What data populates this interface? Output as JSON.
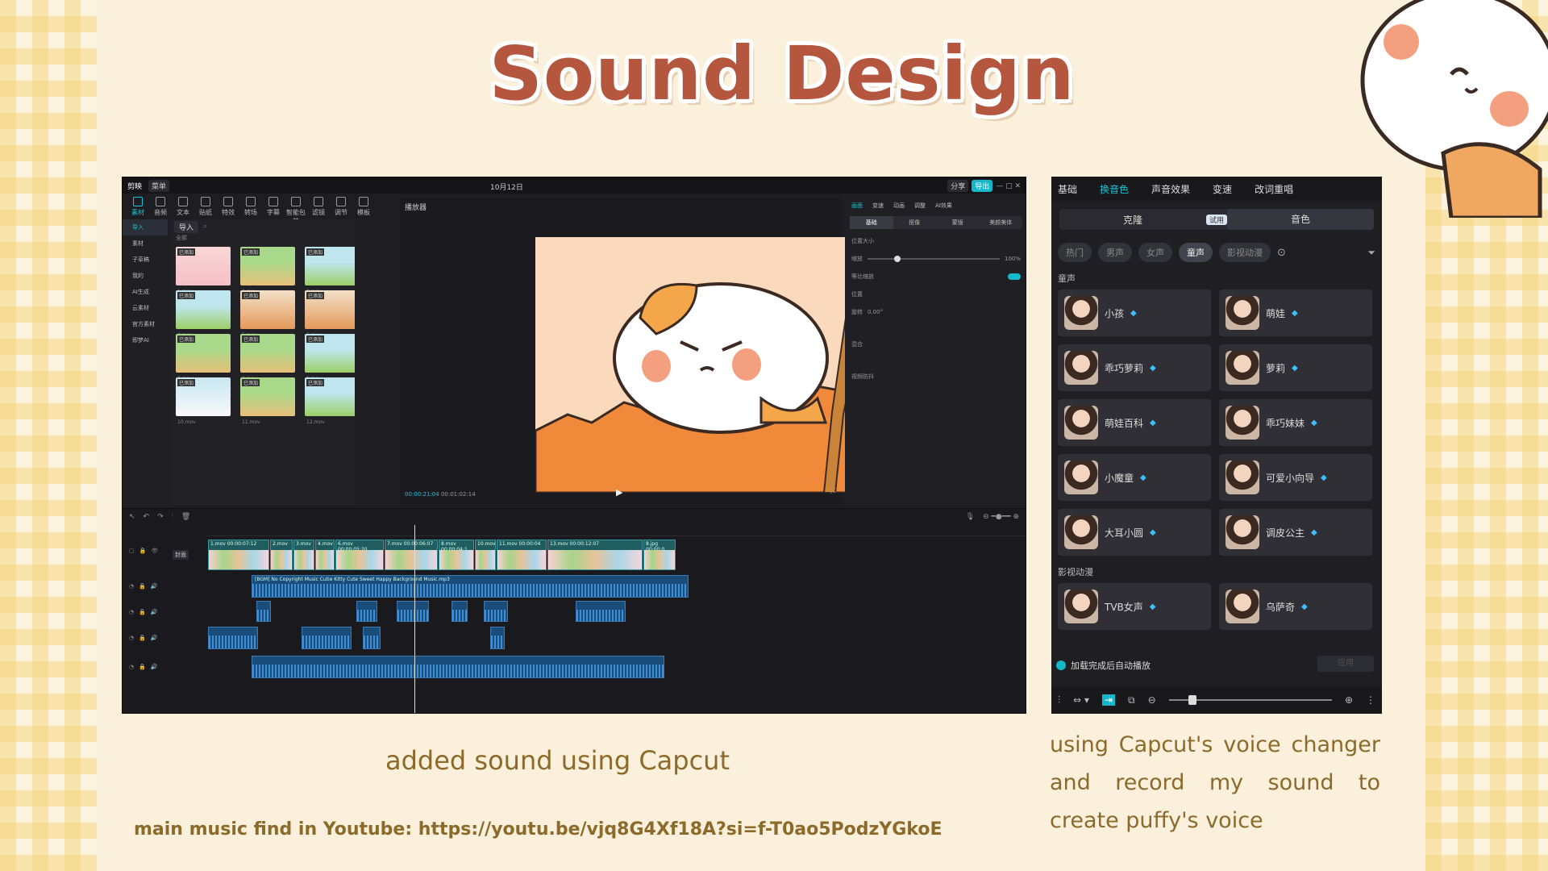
{
  "title": "Sound Design",
  "captions": {
    "left": "added sound using Capcut",
    "link": "main music find in Youtube: https://youtu.be/vjq8G4Xf18A?si=f-T0ao5PodzYGkoE",
    "right": "using Capcut's voice changer and record my sound to create puffy's voice"
  },
  "editor": {
    "app_name": "剪映",
    "menu_label": "菜单",
    "date": "10月12日",
    "share": "分享",
    "export": "导出",
    "toolbar": [
      "素材",
      "音频",
      "文本",
      "贴纸",
      "特效",
      "转场",
      "字幕",
      "智能包装",
      "滤镜",
      "调节",
      "模板"
    ],
    "sidebar": [
      "导入",
      "素材",
      "子草稿",
      "我的",
      "AI生成",
      "云素材",
      "官方素材",
      "即梦AI"
    ],
    "media_import": "导入",
    "media_all": "全部",
    "media_items": [
      {
        "name": "1.mov",
        "badge": "已添加",
        "style": "t1"
      },
      {
        "name": "2.mov",
        "badge": "已添加",
        "style": "t2"
      },
      {
        "name": "3.mov",
        "badge": "已添加",
        "style": "t3"
      },
      {
        "name": "4.mov",
        "badge": "已添加",
        "style": "t3"
      },
      {
        "name": "5.mov",
        "badge": "已添加",
        "style": "t4"
      },
      {
        "name": "6.mov",
        "badge": "已添加",
        "style": "t4"
      },
      {
        "name": "7.mov",
        "badge": "已添加",
        "style": "t2"
      },
      {
        "name": "8.mov",
        "badge": "已添加",
        "style": "t2"
      },
      {
        "name": "9.mov",
        "badge": "已添加",
        "style": "t3"
      },
      {
        "name": "10.mov",
        "badge": "已添加",
        "style": "t5"
      },
      {
        "name": "11.mov",
        "badge": "已添加",
        "style": "t2"
      },
      {
        "name": "12.mov",
        "badge": "已添加",
        "style": "t3"
      }
    ],
    "player_label": "播放器",
    "timecode_current": "00:00:21:04",
    "timecode_total": "00:01:02:14",
    "prop_tabs": [
      "画面",
      "变速",
      "动画",
      "调整",
      "AI效果"
    ],
    "prop_subtabs": [
      "基础",
      "抠像",
      "蒙版",
      "美颜美体"
    ],
    "prop_rows": {
      "size": "位置大小",
      "scale": "缩放",
      "scale_value": "100%",
      "uniform": "等比缩放",
      "position": "位置",
      "rotate": "旋转",
      "rotate_value": "0.00°",
      "blend": "混合",
      "stabilize": "视频防抖"
    },
    "timeline": {
      "cover_label": "封面",
      "music_clip": "[BGM] No Copyright Music Cutie Kitty  Cute  Sweet  Happy Background Music.mp3",
      "video_clips": [
        "1.mov 00:00:07:12",
        "2.mov",
        "3.mov",
        "4.mov",
        "6.mov 00:00:05:20",
        "7.mov 00:00:06:07",
        "8.mov 00:00:04:1",
        "10.mov",
        "11.mov 00:00:04",
        "13.mov 00:00:12:07",
        "8.jpg 00:00:0"
      ]
    }
  },
  "voice": {
    "tabs": [
      "基础",
      "换音色",
      "声音效果",
      "变速",
      "改词重唱"
    ],
    "active_tab": "换音色",
    "switch": [
      "克隆",
      "音色"
    ],
    "switch_tag": "试用",
    "filters": [
      "热门",
      "男声",
      "女声",
      "童声",
      "影视动漫"
    ],
    "active_filter": "童声",
    "section_child": "童声",
    "child_voices": [
      "小孩",
      "萌娃",
      "乖巧萝莉",
      "萝莉",
      "萌娃百科",
      "乖巧妹妹",
      "小魔童",
      "可爱小向导",
      "大耳小圆",
      "调皮公主"
    ],
    "section_anime": "影视动漫",
    "anime_voices": [
      "TVB女声",
      "乌萨奇"
    ],
    "auto_play": "加载完成后自动播放",
    "apply": "应用"
  }
}
